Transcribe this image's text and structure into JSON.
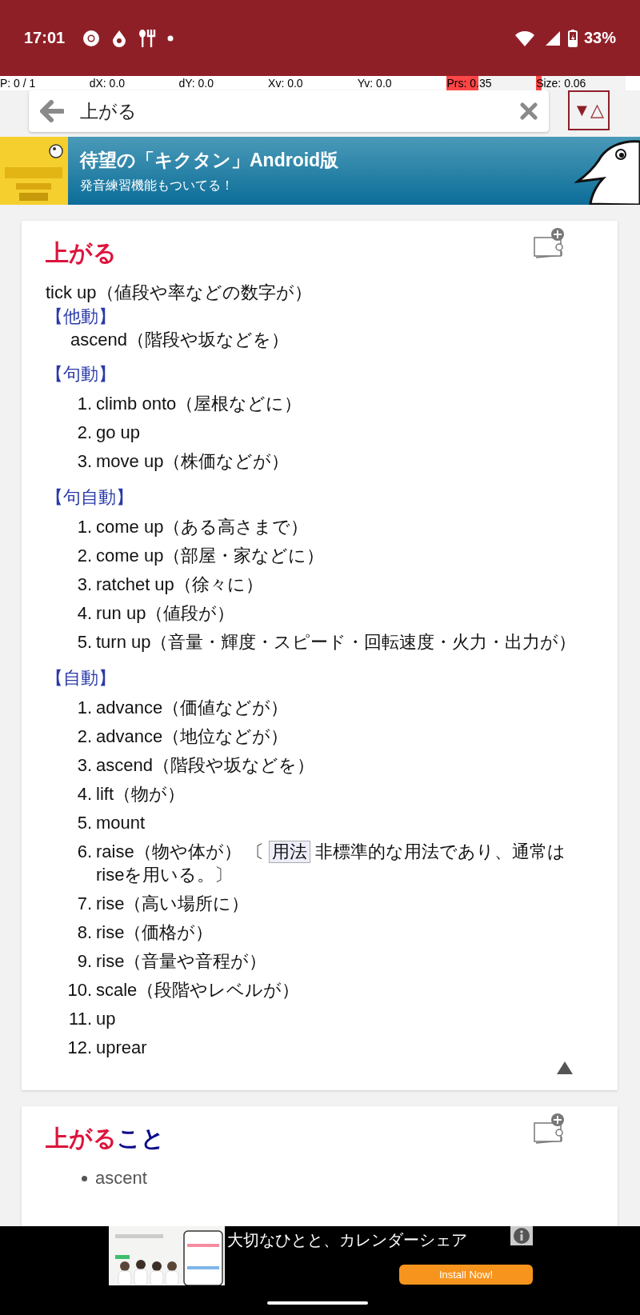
{
  "status_bar": {
    "time": "17:01",
    "battery": "33%"
  },
  "pointer_info": [
    {
      "label": "P: 0 / 1"
    },
    {
      "label": "dX: 0.0"
    },
    {
      "label": "dY: 0.0"
    },
    {
      "label": "Xv: 0.0"
    },
    {
      "label": "Yv: 0.0"
    },
    {
      "label": "Prs: 0.35",
      "level": 0.35
    },
    {
      "label": "Size: 0.06",
      "level": 0.06
    }
  ],
  "search": {
    "value": "上がる",
    "toggle": [
      "▼",
      "△"
    ]
  },
  "banner": {
    "title": "待望の「キクタン」Android版",
    "subtitle": "発音練習機能もついてる！"
  },
  "entries": [
    {
      "title": [
        {
          "kind": "match",
          "text": "上がる"
        }
      ],
      "collapsible": true,
      "blocks": [
        {
          "kind": "line",
          "text": "tick up（値段や率などの数字が）"
        },
        {
          "kind": "pos",
          "text": "【他動】"
        },
        {
          "kind": "indent",
          "text": "ascend（階段や坂などを）"
        },
        {
          "kind": "pos",
          "text": "【句動】"
        },
        {
          "kind": "list",
          "items": [
            {
              "num": "1.",
              "text": "climb onto（屋根などに）"
            },
            {
              "num": "2.",
              "text": "go up"
            },
            {
              "num": "3.",
              "text": "move up（株価などが）"
            }
          ]
        },
        {
          "kind": "pos",
          "text": "【句自動】"
        },
        {
          "kind": "list",
          "items": [
            {
              "num": "1.",
              "text": "come up（ある高さまで）"
            },
            {
              "num": "2.",
              "text": "come up（部屋・家などに）"
            },
            {
              "num": "3.",
              "text": "ratchet up（徐々に）"
            },
            {
              "num": "4.",
              "text": "run up（値段が）"
            },
            {
              "num": "5.",
              "text": "turn up（音量・輝度・スピード・回転速度・火力・出力が）"
            }
          ]
        },
        {
          "kind": "pos",
          "text": "【自動】"
        },
        {
          "kind": "list",
          "items": [
            {
              "num": "1.",
              "text": "advance（価値などが）"
            },
            {
              "num": "2.",
              "text": "advance（地位などが）"
            },
            {
              "num": "3.",
              "text": "ascend（階段や坂などを）"
            },
            {
              "num": "4.",
              "text": "lift（物が）"
            },
            {
              "num": "5.",
              "text": "mount"
            },
            {
              "num": "6.",
              "text": "raise（物や体が）",
              "note": {
                "open": "〔",
                "label": "用法",
                "body": "非標準的な用法であり、通常はriseを用いる。〕"
              }
            },
            {
              "num": "7.",
              "text": "rise（高い場所に）"
            },
            {
              "num": "8.",
              "text": "rise（価格が）"
            },
            {
              "num": "9.",
              "text": "rise（音量や音程が）"
            },
            {
              "num": "10.",
              "text": "scale（段階やレベルが）"
            },
            {
              "num": "11.",
              "text": "up"
            },
            {
              "num": "12.",
              "text": "uprear"
            }
          ]
        }
      ]
    },
    {
      "title": [
        {
          "kind": "match",
          "text": "上がる"
        },
        {
          "kind": "rest",
          "text": "こと"
        }
      ],
      "collapsible": false,
      "blocks": [
        {
          "kind": "bullets",
          "items": [
            "ascent"
          ]
        }
      ]
    }
  ],
  "ad": {
    "headline": "大切なひとと、カレンダーシェア",
    "button": "Install Now!"
  }
}
